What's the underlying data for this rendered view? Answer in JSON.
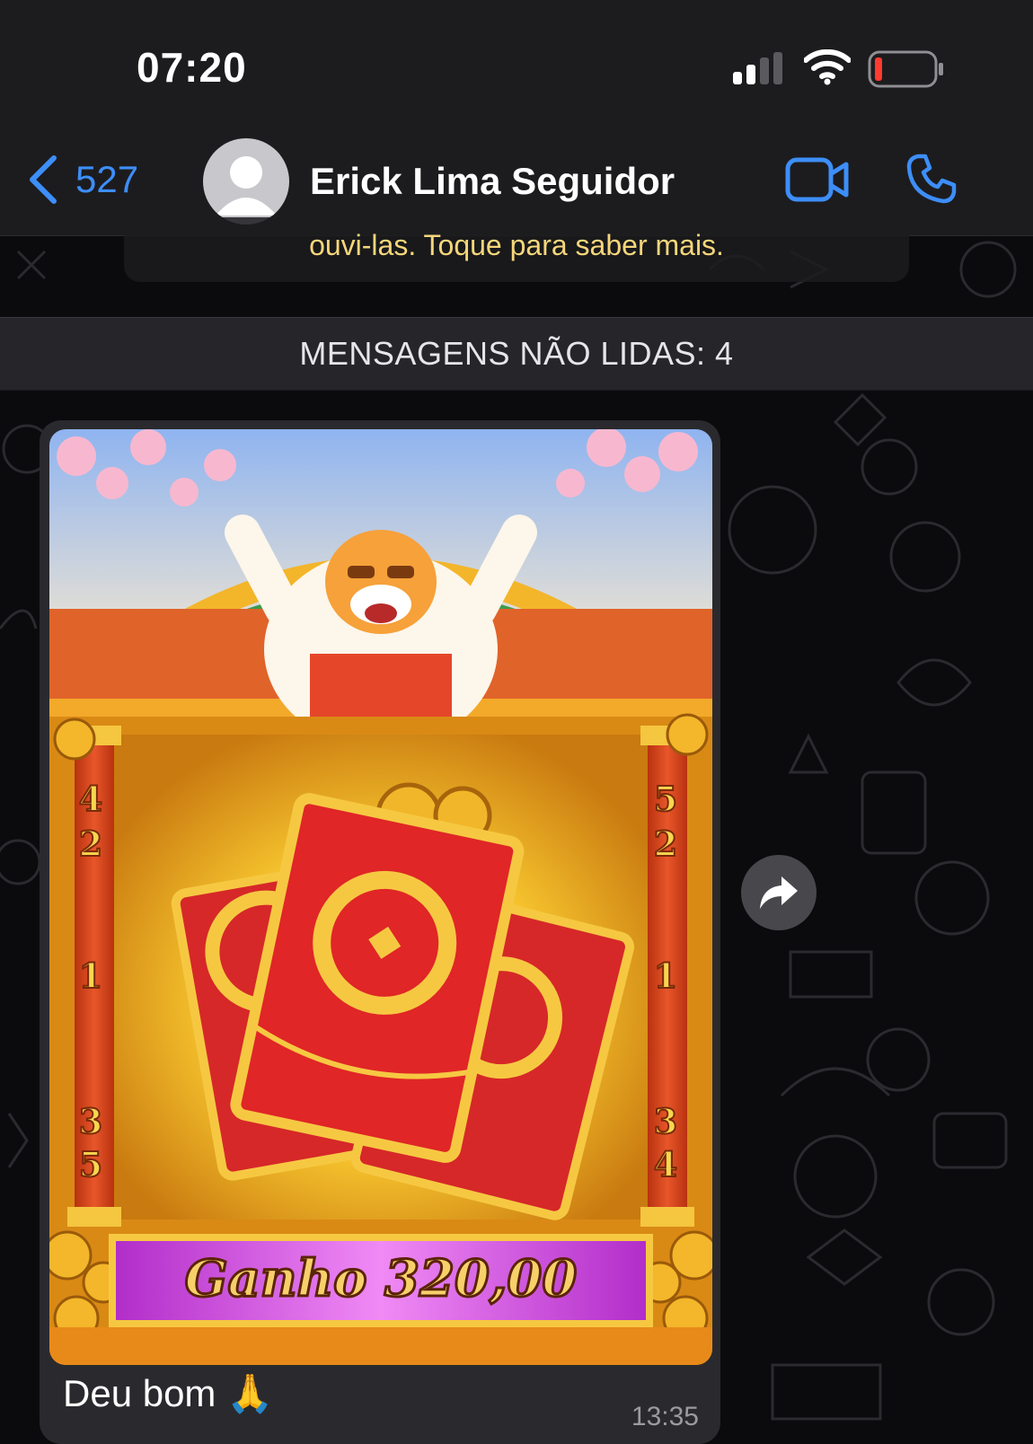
{
  "status_bar": {
    "time": "07:20",
    "signal_icon": "cellular-signal-icon",
    "wifi_icon": "wifi-icon",
    "battery_icon": "battery-low-icon"
  },
  "header": {
    "back_count": "527",
    "back_icon": "chevron-left-icon",
    "contact_name": "Erick Lima Seguidor",
    "avatar_icon": "person-silhouette-icon",
    "video_icon": "video-camera-icon",
    "phone_icon": "phone-icon",
    "accent_color": "#3d8ef8"
  },
  "security_notice": {
    "text": "ouvi-las. Toque para saber mais."
  },
  "unread_divider": {
    "text": "MENSAGENS NÃO LIDAS: 4"
  },
  "message": {
    "image": {
      "reels_left": [
        "4",
        "2",
        "1",
        "3",
        "5"
      ],
      "reels_right": [
        "5",
        "2",
        "1",
        "3",
        "4"
      ],
      "win_label": "Ganho 320,00"
    },
    "caption": "Deu bom 🙏",
    "time": "13:35",
    "forward_icon": "forward-arrow-icon"
  }
}
